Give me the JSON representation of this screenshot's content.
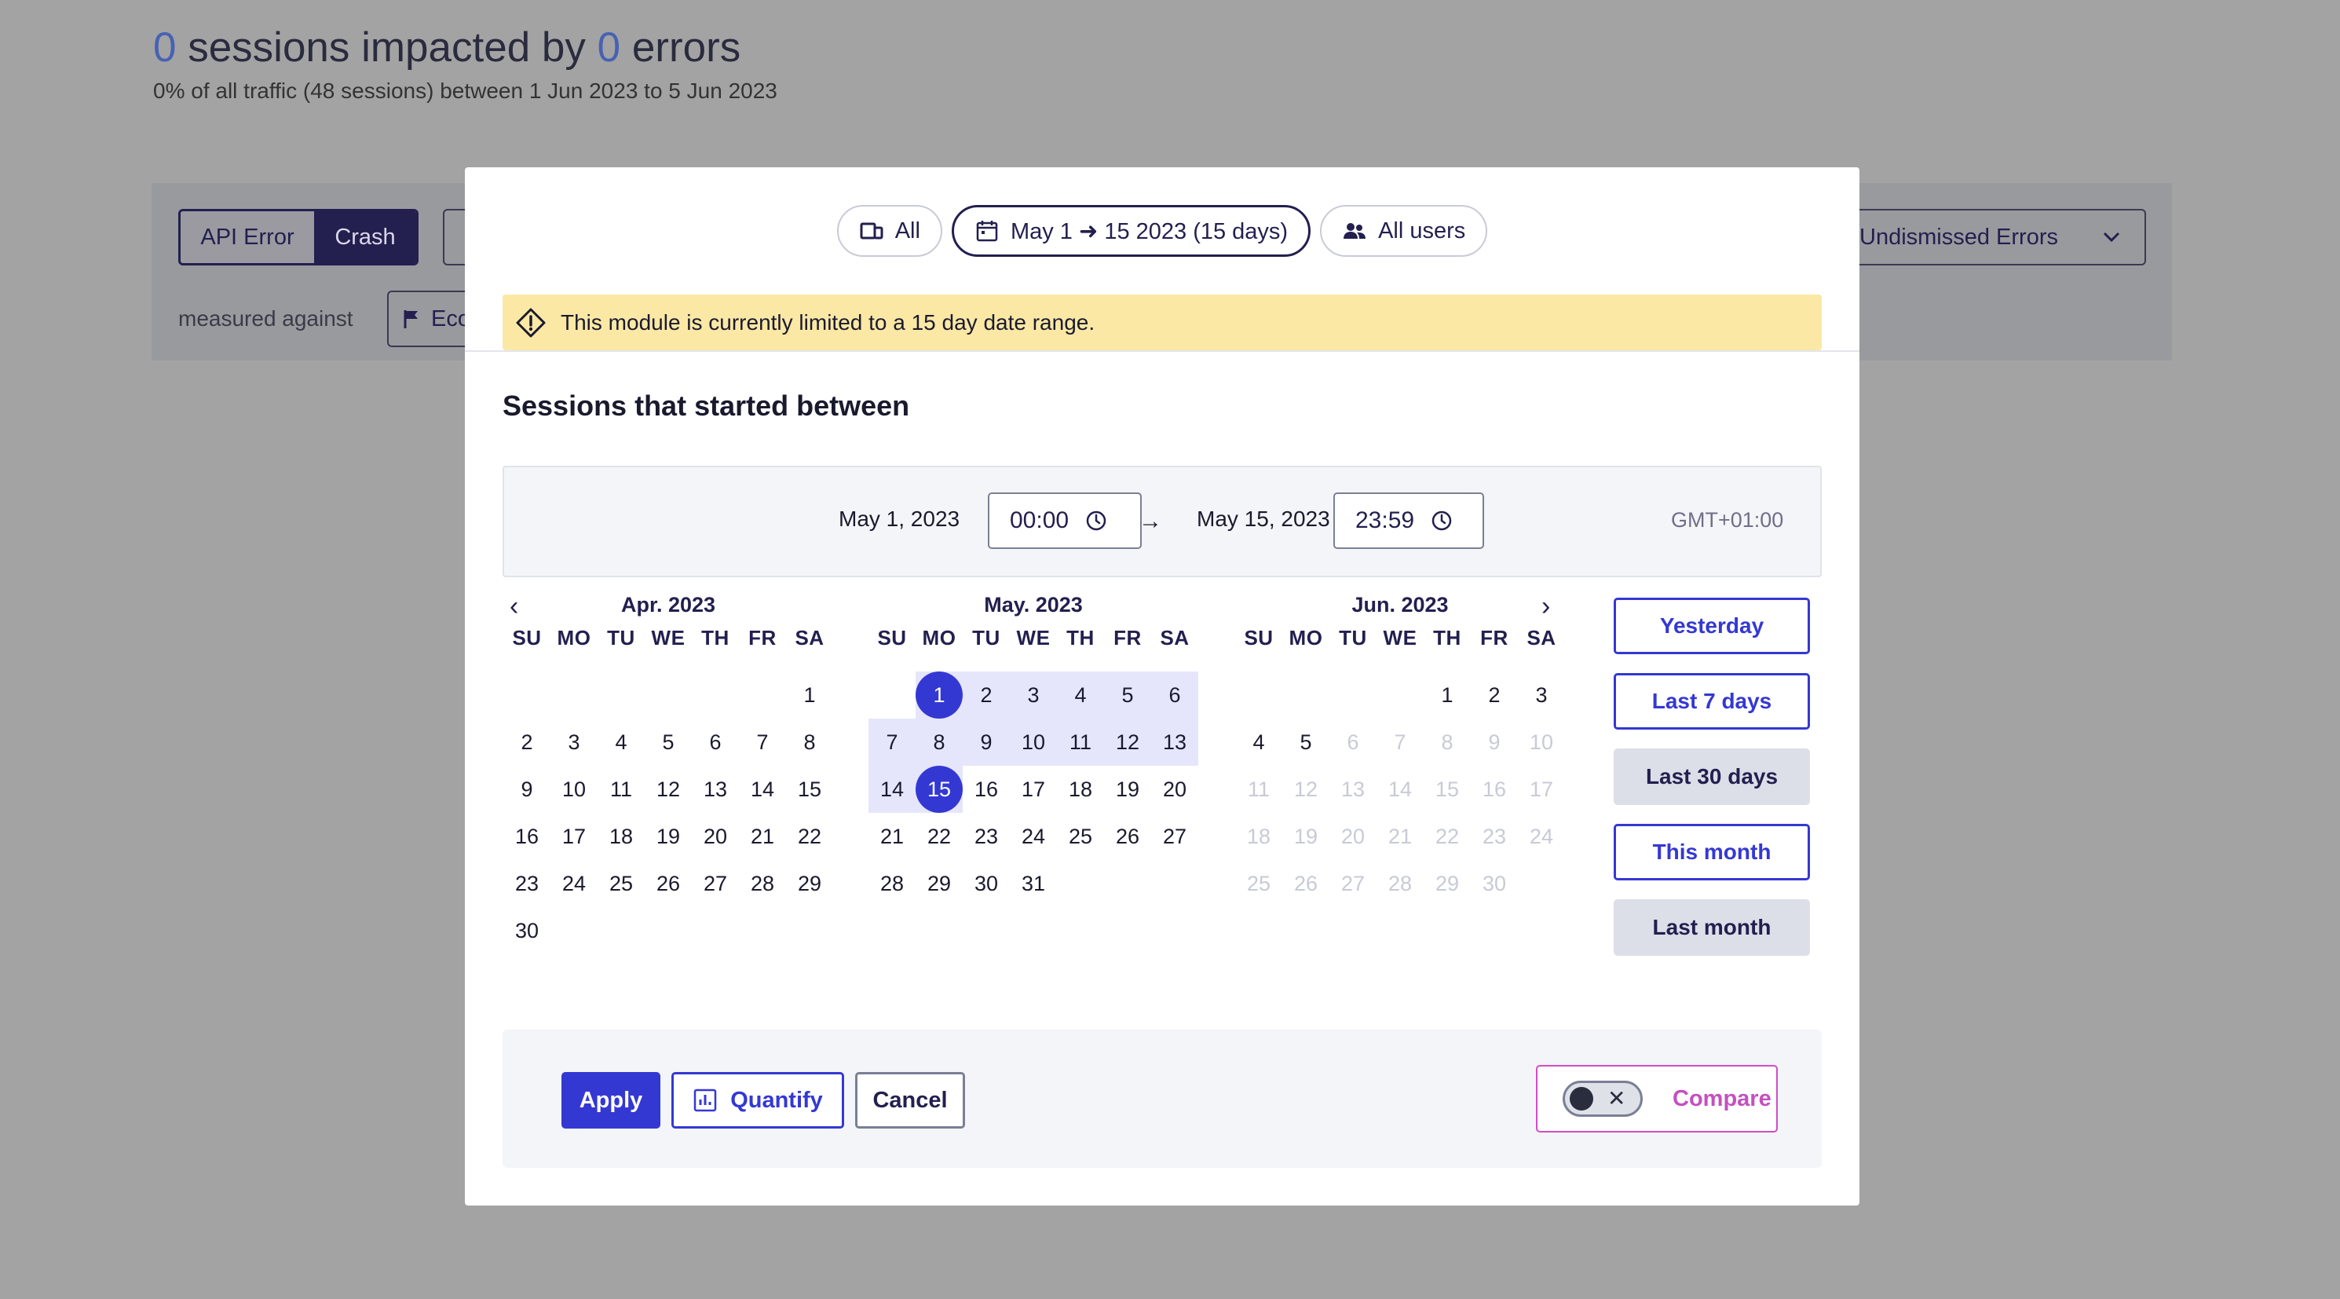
{
  "background": {
    "headline": {
      "count_sessions": "0",
      "text_mid": " sessions impacted by ",
      "count_errors": "0",
      "text_end": " errors"
    },
    "subline": "0% of all traffic (48 sessions) between 1 Jun 2023 to 5 Jun 2023",
    "segment": {
      "api_error": "API Error",
      "crash": "Crash"
    },
    "measured_against": "measured against",
    "eco_label": "Eco",
    "undismissed": "Undismissed Errors"
  },
  "modal": {
    "filters": {
      "all": "All",
      "date_range": "May 1 ➜ 15 2023 (15 days)",
      "users": "All users"
    },
    "notice": "This module is currently limited to a 15 day date range.",
    "section_title": "Sessions that started between",
    "time_bar": {
      "start_date": "May 1, 2023",
      "start_time": "00:00",
      "end_date": "May 15, 2023",
      "end_time": "23:59",
      "timezone": "GMT+01:00"
    },
    "weekdays": [
      "SU",
      "MO",
      "TU",
      "WE",
      "TH",
      "FR",
      "SA"
    ],
    "calendars": [
      {
        "title": "Apr. 2023",
        "offset": 6,
        "days": 30,
        "selected": [],
        "range": [],
        "disabled_from": 99
      },
      {
        "title": "May. 2023",
        "offset": 1,
        "days": 31,
        "selected": [
          1,
          15
        ],
        "range": [
          1,
          15
        ],
        "disabled_from": 99
      },
      {
        "title": "Jun. 2023",
        "offset": 4,
        "days": 30,
        "selected": [],
        "range": [],
        "disabled_from": 6
      }
    ],
    "presets": [
      {
        "label": "Yesterday",
        "style": "outline"
      },
      {
        "label": "Last 7 days",
        "style": "outline"
      },
      {
        "label": "Last 30 days",
        "style": "filled"
      },
      {
        "label": "This month",
        "style": "outline"
      },
      {
        "label": "Last month",
        "style": "filled"
      }
    ],
    "footer": {
      "apply": "Apply",
      "quantify": "Quantify",
      "cancel": "Cancel",
      "compare": "Compare"
    }
  },
  "colors": {
    "accent": "#3438d3",
    "range_fill": "#e5e6fb",
    "notice_bg": "#fbe8a5",
    "compare": "#c54fc0"
  }
}
